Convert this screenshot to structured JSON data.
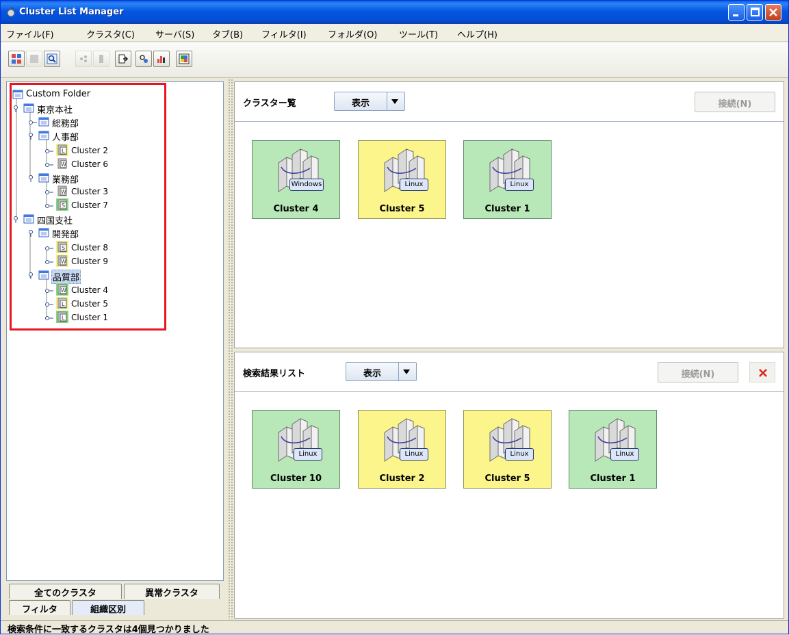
{
  "window": {
    "title": "Cluster List Manager"
  },
  "menu": [
    "ファイル(F)",
    "クラスタ(C)",
    "サーバ(S)",
    "タブ(B)",
    "フィルタ(I)",
    "フォルダ(O)",
    "ツール(T)",
    "ヘルプ(H)"
  ],
  "tree": {
    "root": "Custom Folder",
    "nodes": [
      {
        "label": "東京本社"
      },
      {
        "label": "総務部"
      },
      {
        "label": "人事部"
      },
      {
        "label": "Cluster 2",
        "os": "L"
      },
      {
        "label": "Cluster 6",
        "os": "W"
      },
      {
        "label": "業務部"
      },
      {
        "label": "Cluster 3",
        "os": "W"
      },
      {
        "label": "Cluster 7",
        "os": "S"
      },
      {
        "label": "四国支社"
      },
      {
        "label": "開発部"
      },
      {
        "label": "Cluster 8",
        "os": "S"
      },
      {
        "label": "Cluster 9",
        "os": "W"
      },
      {
        "label": "品質部"
      },
      {
        "label": "Cluster 4",
        "os": "W"
      },
      {
        "label": "Cluster 5",
        "os": "L"
      },
      {
        "label": "Cluster 1",
        "os": "L"
      }
    ]
  },
  "left_tabs": {
    "all_clusters": "全てのクラスタ",
    "abnormal_clusters": "異常クラスタ",
    "filter": "フィルタ",
    "by_organization": "組織区別"
  },
  "cluster_list": {
    "title": "クラスター覧",
    "view_label": "表示",
    "connect_label": "接続(N)",
    "cards": [
      {
        "name": "Cluster 4",
        "os": "Windows",
        "color": "green"
      },
      {
        "name": "Cluster 5",
        "os": "Linux",
        "color": "yellow"
      },
      {
        "name": "Cluster 1",
        "os": "Linux",
        "color": "green"
      }
    ]
  },
  "search_results": {
    "title": "検索結果リスト",
    "view_label": "表示",
    "connect_label": "接続(N)",
    "cards": [
      {
        "name": "Cluster 10",
        "os": "Linux",
        "color": "green"
      },
      {
        "name": "Cluster 2",
        "os": "Linux",
        "color": "yellow"
      },
      {
        "name": "Cluster 5",
        "os": "Linux",
        "color": "yellow"
      },
      {
        "name": "Cluster 1",
        "os": "Linux",
        "color": "green"
      }
    ]
  },
  "status": {
    "text": "検索条件に一致するクラスタは4個見つかりました"
  },
  "colors": {
    "card_green": "#b8e7b8",
    "card_yellow": "#fbf58c",
    "highlight": "#e8141e",
    "titlebar": "#0556e0"
  }
}
